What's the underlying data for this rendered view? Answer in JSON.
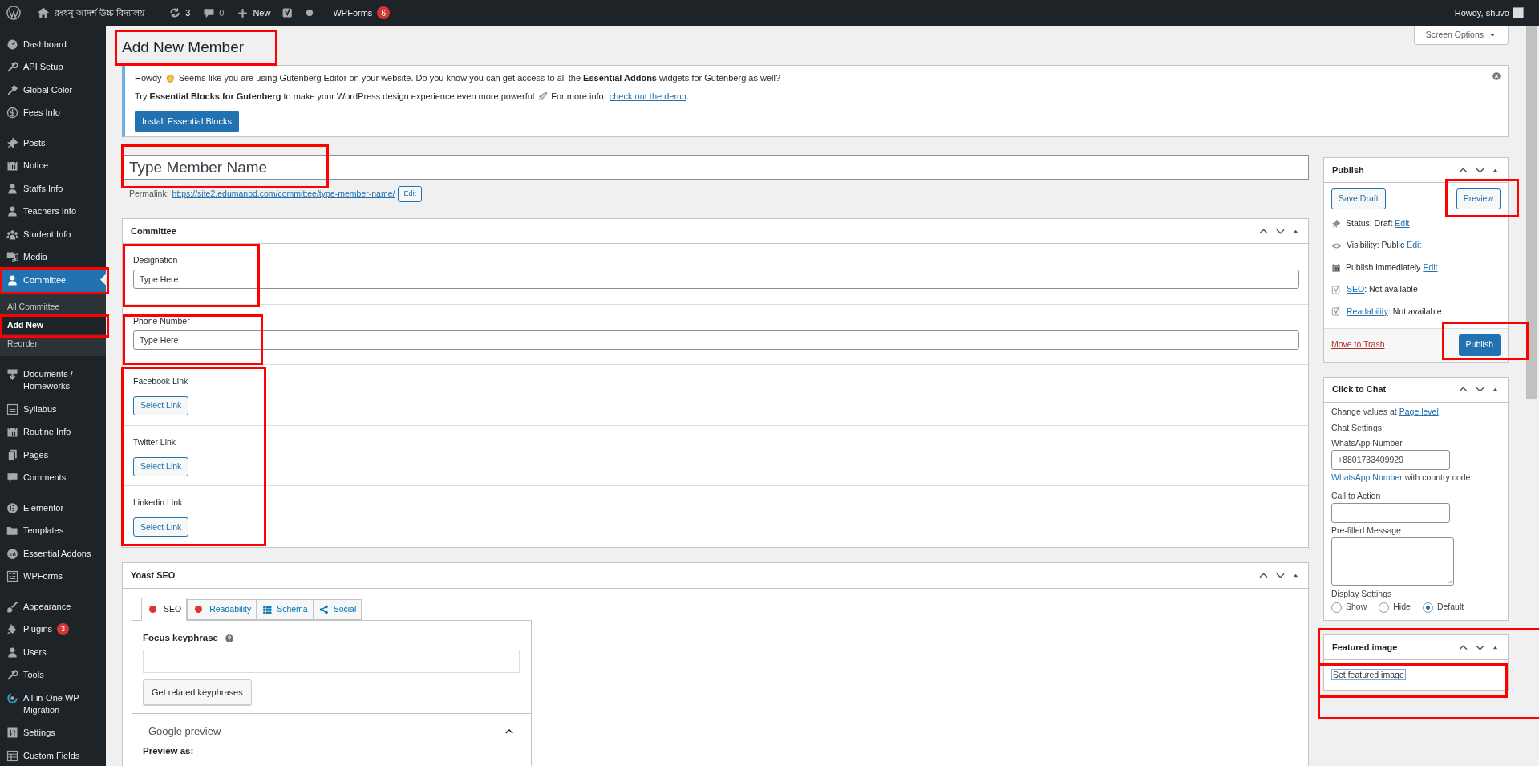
{
  "admin_bar": {
    "site_name": "রংধনু আদর্শ উচ্চ বিদ্যালয়",
    "updates": "3",
    "comments": "0",
    "new": "New",
    "wpforms": "WPForms",
    "wpforms_badge": "6",
    "greeting": "Howdy, shuvo"
  },
  "sidebar": {
    "groups": [
      [
        {
          "label": "Dashboard",
          "selected": false
        },
        {
          "label": "API Setup",
          "selected": false
        },
        {
          "label": "Global Color",
          "selected": false
        },
        {
          "label": "Fees Info",
          "selected": false
        }
      ],
      [
        {
          "label": "Posts",
          "selected": false
        },
        {
          "label": "Notice",
          "selected": false
        },
        {
          "label": "Staffs Info",
          "selected": false
        },
        {
          "label": "Teachers Info",
          "selected": false
        },
        {
          "label": "Student Info",
          "selected": false
        },
        {
          "label": "Media",
          "selected": false
        },
        {
          "label": "Committee",
          "selected": true,
          "children": [
            {
              "label": "All Committee",
              "selected": false
            },
            {
              "label": "Add New",
              "selected": true
            },
            {
              "label": "Reorder",
              "selected": false
            }
          ]
        }
      ],
      [
        {
          "label": "Documents / Homeworks",
          "selected": false
        },
        {
          "label": "Syllabus",
          "selected": false
        },
        {
          "label": "Routine Info",
          "selected": false
        },
        {
          "label": "Pages",
          "selected": false
        },
        {
          "label": "Comments",
          "selected": false
        }
      ],
      [
        {
          "label": "Elementor",
          "selected": false
        },
        {
          "label": "Templates",
          "selected": false
        },
        {
          "label": "Essential Addons",
          "selected": false
        },
        {
          "label": "WPForms",
          "selected": false
        }
      ],
      [
        {
          "label": "Appearance",
          "selected": false
        },
        {
          "label": "Plugins",
          "selected": false,
          "badge": "3"
        },
        {
          "label": "Users",
          "selected": false
        },
        {
          "label": "Tools",
          "selected": false
        },
        {
          "label": "All-in-One WP Migration",
          "selected": false
        },
        {
          "label": "Settings",
          "selected": false
        },
        {
          "label": "Custom Fields",
          "selected": false
        }
      ]
    ]
  },
  "page_title": "Add New Member",
  "screen_options": "Screen Options",
  "notice": {
    "greeting": "Howdy",
    "line1": "Seems like you are using Gutenberg Editor on your website. Do you know you can get access to all the **Essential Addons** widgets for Gutenberg as well?",
    "line2": "Try **Essential Blocks for Gutenberg** to make your WordPress design experience even more powerful",
    "more_info": "For more info,",
    "link": "check out the demo",
    "link_after": ".",
    "button": "Install Essential Blocks"
  },
  "title_field": {
    "placeholder": "Type Member Name"
  },
  "permalink": {
    "label": "Permalink:",
    "url": "https://site2.edumanbd.com/committee/type-member-name/",
    "edit": "Edit"
  },
  "committee": {
    "title": "Committee",
    "fields": [
      {
        "kind": "text",
        "label": "Designation",
        "value": "Type Here"
      },
      {
        "kind": "text",
        "label": "Phone Number",
        "value": "Type Here"
      },
      {
        "kind": "link",
        "label": "Facebook Link",
        "button": "Select Link"
      },
      {
        "kind": "link",
        "label": "Twitter Link",
        "button": "Select Link"
      },
      {
        "kind": "link",
        "label": "Linkedin Link",
        "button": "Select Link"
      }
    ]
  },
  "yoast": {
    "title": "Yoast SEO",
    "tabs": [
      {
        "kind": "score",
        "label": "SEO",
        "selected": true
      },
      {
        "kind": "score",
        "label": "Readability",
        "selected": false
      },
      {
        "kind": "schema",
        "label": "Schema",
        "selected": false
      },
      {
        "kind": "social",
        "label": "Social",
        "selected": false
      }
    ],
    "focus_label": "Focus keyphrase",
    "related_button": "Get related keyphrases",
    "google_preview": "Google preview",
    "preview_as": "Preview as:"
  },
  "publish": {
    "title": "Publish",
    "save_draft": "Save Draft",
    "preview": "Preview",
    "rows": [
      {
        "kind": "status",
        "before": "Status: Draft",
        "link": "Edit"
      },
      {
        "kind": "visibility",
        "before": "Visibility: Public",
        "link": "Edit"
      },
      {
        "kind": "schedule",
        "before": "Publish immediately",
        "link": "Edit"
      },
      {
        "kind": "seo",
        "link": "SEO",
        "after": ": Not available"
      },
      {
        "kind": "seo",
        "link": "Readability",
        "after": ": Not available"
      }
    ],
    "trash": "Move to Trash",
    "publish_button": "Publish"
  },
  "click_to_chat": {
    "title": "Click to Chat",
    "change_values": "Change values at",
    "page_level": "Page level",
    "chat_settings": "Chat Settings:",
    "whatsapp_label": "WhatsApp Number",
    "whatsapp_value": "+8801733409929",
    "hint_link": "WhatsApp Number",
    "hint": "with country code",
    "cta_label": "Call to Action",
    "prefilled_label": "Pre-filled Message",
    "display_label": "Display Settings",
    "radios": [
      {
        "label": "Show",
        "selected": false
      },
      {
        "label": "Hide",
        "selected": false
      },
      {
        "label": "Default",
        "selected": true
      }
    ]
  },
  "featured_image": {
    "title": "Featured image",
    "link": "Set featured image"
  }
}
